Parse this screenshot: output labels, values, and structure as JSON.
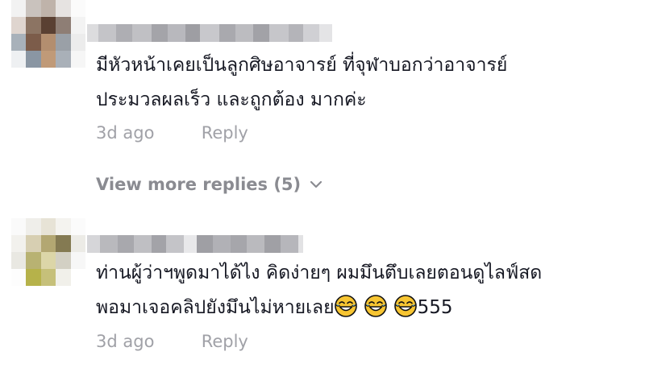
{
  "comments": [
    {
      "text_lines": [
        "มีหัวหน้าเคยเป็นลูกศิษอาจารย์ ที่จุฬาบอกว่าอาจารย์",
        "ประมวลผลเร็ว และถูกต้อง มากค่ะ"
      ],
      "time": "3d ago",
      "reply_label": "Reply",
      "view_more_label": "View more replies (5)",
      "view_more_icon": "chevron-down-icon"
    },
    {
      "text_lines": [
        "ท่านผู้ว่าฯพูดมาได้ไง คิดง่ายๆ ผมมึนตึบเลยตอนดูไลฟ์สด",
        "พอมาเจอคลิปยังมึนไม่หายเลย"
      ],
      "emoji_icon": "face-with-tears-of-joy-icon",
      "text_suffix": "555",
      "time": "3d ago",
      "reply_label": "Reply"
    }
  ],
  "colors": {
    "text": "#161823",
    "meta": "#a0a1a7",
    "view_more": "#8a8b91"
  }
}
